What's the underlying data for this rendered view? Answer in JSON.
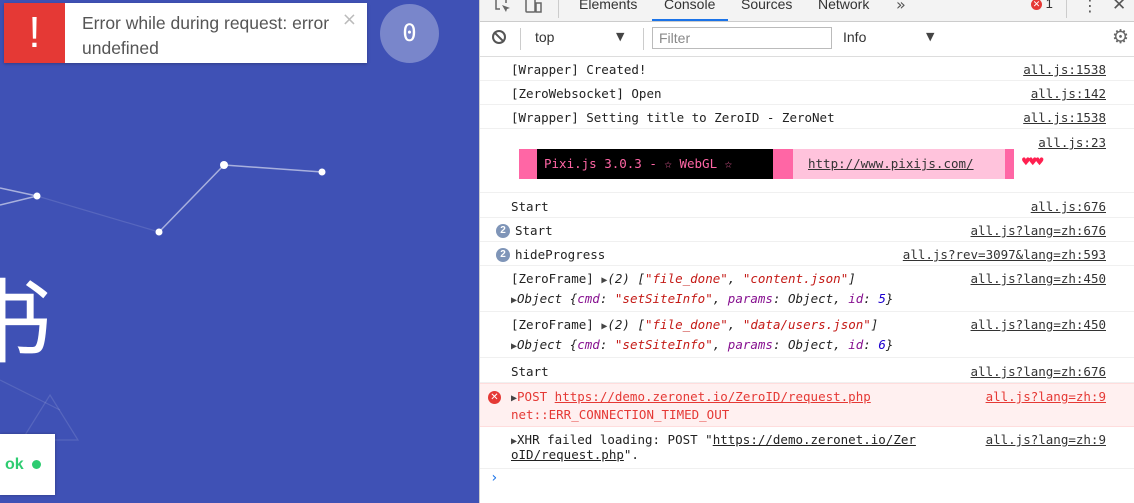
{
  "page": {
    "notification": {
      "icon": "!",
      "message": "Error while during request: error undefined",
      "close": "×"
    },
    "counter": "0",
    "big_text": "书",
    "status": {
      "label": "ok"
    }
  },
  "devtools": {
    "tabs": [
      "Elements",
      "Console",
      "Sources",
      "Network"
    ],
    "active_tab": "Console",
    "more": "»",
    "error_count": "1",
    "toolbar": {
      "context": "top",
      "filter_placeholder": "Filter",
      "level": "Info"
    },
    "logs": {
      "l1": {
        "msg": "[Wrapper] Created!",
        "src": "all.js:1538"
      },
      "l2": {
        "msg": "[ZeroWebsocket] Open",
        "src": "all.js:142"
      },
      "l3": {
        "msg": "[Wrapper] Setting title to ZeroID - ZeroNet",
        "src": "all.js:1538"
      },
      "l4": {
        "banner": "Pixi.js 3.0.3 - ☆ WebGL ☆",
        "link": "http://www.pixijs.com/",
        "hearts": "♥♥♥",
        "src": "all.js:23"
      },
      "l5": {
        "msg": "Start",
        "src": "all.js:676"
      },
      "l6": {
        "count": "2",
        "msg": "Start",
        "src": "all.js?lang=zh:676"
      },
      "l7": {
        "count": "2",
        "msg": "hideProgress",
        "src": "all.js?rev=3097&lang=zh:593"
      },
      "l8": {
        "prefix": "[ZeroFrame]",
        "array_len": "(2)",
        "a1": "\"file_done\"",
        "a2": "\"content.json\"",
        "obj": "Object",
        "cmd_val": "\"setSiteInfo\"",
        "id_val": "5",
        "src": "all.js?lang=zh:450"
      },
      "l9": {
        "prefix": "[ZeroFrame]",
        "array_len": "(2)",
        "a1": "\"file_done\"",
        "a2": "\"data/users.json\"",
        "obj": "Object",
        "cmd_val": "\"setSiteInfo\"",
        "id_val": "6",
        "src": "all.js?lang=zh:450"
      },
      "l10": {
        "msg": "Start",
        "src": "all.js?lang=zh:676"
      },
      "l11": {
        "method": "POST",
        "url": "https://demo.zeronet.io/ZeroID/request.php",
        "error": "net::ERR_CONNECTION_TIMED_OUT",
        "src": "all.js?lang=zh:9"
      },
      "l12": {
        "prefix": "XHR failed loading: POST \"",
        "url1": "https://demo.zeronet.io/Zer",
        "url2": "oID/request.php",
        "suffix": "\".",
        "src": "all.js?lang=zh:9"
      }
    },
    "prompt": "›"
  }
}
